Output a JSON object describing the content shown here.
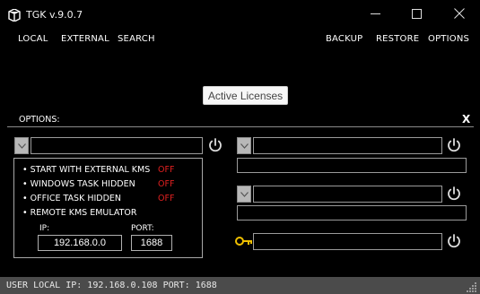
{
  "window": {
    "title": "TGK v.9.0.7"
  },
  "menu": {
    "left": [
      "LOCAL",
      "EXTERNAL",
      "SEARCH"
    ],
    "right": [
      "BACKUP",
      "RESTORE",
      "OPTIONS"
    ]
  },
  "tooltip": "Active Licenses",
  "options_panel": {
    "title": "OPTIONS:",
    "close_label": "X",
    "settings": [
      {
        "label": "• START WITH EXTERNAL KMS",
        "state": "OFF"
      },
      {
        "label": "• WINDOWS TASK HIDDEN",
        "state": "OFF"
      },
      {
        "label": "• OFFICE TASK HIDDEN",
        "state": "OFF"
      },
      {
        "label": "• REMOTE KMS EMULATOR",
        "state": ""
      }
    ],
    "ip_label": "IP:",
    "ip_value": "192.168.0.0",
    "port_label": "PORT:",
    "port_value": "1688"
  },
  "status_bar": {
    "text": "USER LOCAL IP: 192.168.0.108  PORT: 1688"
  },
  "colors": {
    "off": "#e02020",
    "key_icon": "#f0c000",
    "status_bg": "#4b4b4b"
  }
}
